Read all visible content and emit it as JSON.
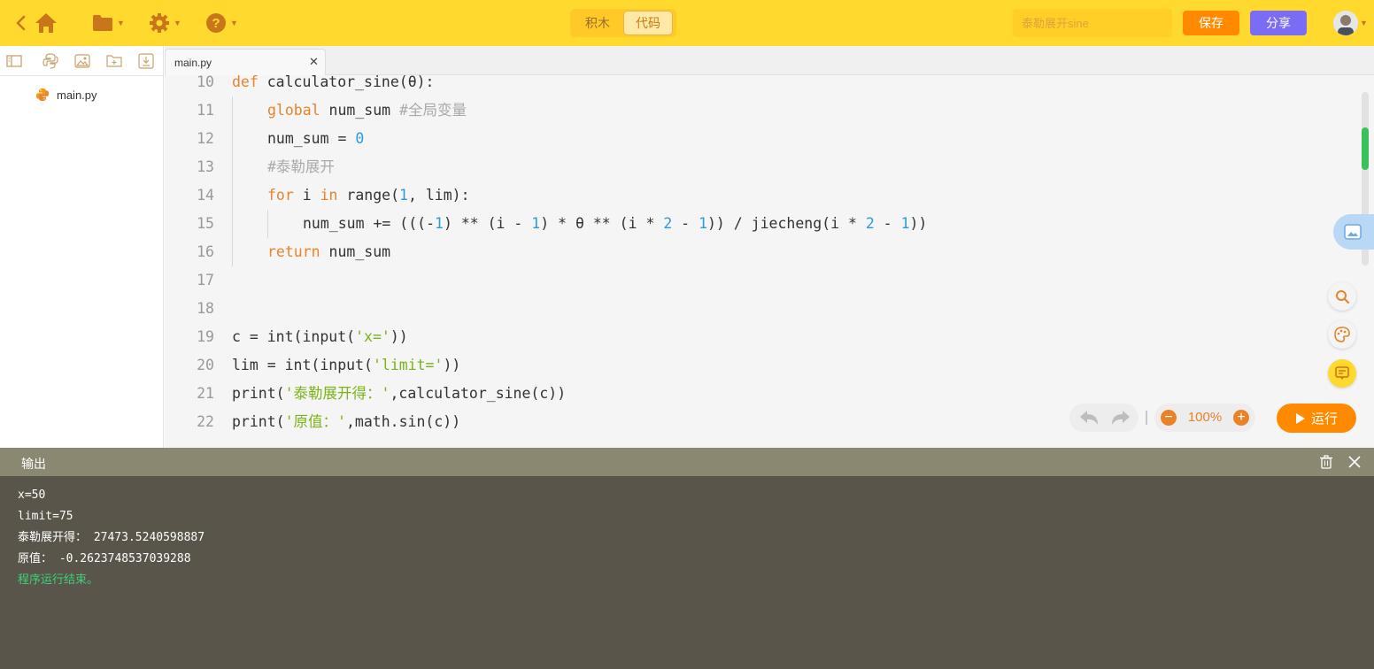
{
  "topbar": {
    "mode_tabs": [
      "积木",
      "代码"
    ],
    "active_mode": "代码",
    "title_input": {
      "value": "",
      "placeholder": "泰勒展开sine"
    },
    "save_label": "保存",
    "share_label": "分享"
  },
  "sidebar": {
    "files": [
      {
        "name": "main.py",
        "icon": "python-icon"
      }
    ]
  },
  "editor": {
    "tab": {
      "label": "main.py",
      "close": "✕"
    },
    "line_numbers": [
      "10",
      "11",
      "12",
      "13",
      "14",
      "15",
      "16",
      "17",
      "18",
      "19",
      "20",
      "21",
      "22"
    ],
    "lines": [
      {
        "indent": 0,
        "tokens": [
          {
            "t": "def",
            "c": "kw"
          },
          {
            "t": " calculator_sine(θ):",
            "c": ""
          }
        ]
      },
      {
        "indent": 1,
        "tokens": [
          {
            "t": "global",
            "c": "kw"
          },
          {
            "t": " num_sum ",
            "c": ""
          },
          {
            "t": "#全局变量",
            "c": "cm"
          }
        ]
      },
      {
        "indent": 1,
        "tokens": [
          {
            "t": "num_sum = ",
            "c": ""
          },
          {
            "t": "0",
            "c": "num"
          }
        ]
      },
      {
        "indent": 1,
        "tokens": [
          {
            "t": "#泰勒展开",
            "c": "cm"
          }
        ]
      },
      {
        "indent": 1,
        "tokens": [
          {
            "t": "for",
            "c": "kw"
          },
          {
            "t": " i ",
            "c": ""
          },
          {
            "t": "in",
            "c": "kw"
          },
          {
            "t": " range(",
            "c": ""
          },
          {
            "t": "1",
            "c": "num"
          },
          {
            "t": ", lim):",
            "c": ""
          }
        ]
      },
      {
        "indent": 2,
        "tokens": [
          {
            "t": "num_sum += (((-",
            "c": ""
          },
          {
            "t": "1",
            "c": "num"
          },
          {
            "t": ") ** (i - ",
            "c": ""
          },
          {
            "t": "1",
            "c": "num"
          },
          {
            "t": ") * θ ** (i * ",
            "c": ""
          },
          {
            "t": "2",
            "c": "num"
          },
          {
            "t": " - ",
            "c": ""
          },
          {
            "t": "1",
            "c": "num"
          },
          {
            "t": ")) / jiecheng(i * ",
            "c": ""
          },
          {
            "t": "2",
            "c": "num"
          },
          {
            "t": " - ",
            "c": ""
          },
          {
            "t": "1",
            "c": "num"
          },
          {
            "t": "))",
            "c": ""
          }
        ]
      },
      {
        "indent": 1,
        "tokens": [
          {
            "t": "return",
            "c": "kw"
          },
          {
            "t": " num_sum",
            "c": ""
          }
        ]
      },
      {
        "indent": 0,
        "tokens": []
      },
      {
        "indent": 0,
        "tokens": []
      },
      {
        "indent": 0,
        "tokens": [
          {
            "t": "c = int(input(",
            "c": ""
          },
          {
            "t": "'x='",
            "c": "str"
          },
          {
            "t": "))",
            "c": ""
          }
        ]
      },
      {
        "indent": 0,
        "tokens": [
          {
            "t": "lim = int(input(",
            "c": ""
          },
          {
            "t": "'limit='",
            "c": "str"
          },
          {
            "t": "))",
            "c": ""
          }
        ]
      },
      {
        "indent": 0,
        "tokens": [
          {
            "t": "print(",
            "c": ""
          },
          {
            "t": "'泰勒展开得：'",
            "c": "str"
          },
          {
            "t": ",calculator_sine(c))",
            "c": ""
          }
        ]
      },
      {
        "indent": 0,
        "tokens": [
          {
            "t": "print(",
            "c": ""
          },
          {
            "t": "'原值：'",
            "c": "str"
          },
          {
            "t": ",math.sin(c))",
            "c": ""
          }
        ]
      }
    ],
    "zoom_level": "100%",
    "run_label": "运行"
  },
  "output": {
    "title": "输出",
    "lines": [
      {
        "text": "x=50",
        "color": "#ffffff"
      },
      {
        "text": "limit=75",
        "color": "#ffffff"
      },
      {
        "text": "泰勒展开得： 27473.5240598887",
        "color": "#ffffff"
      },
      {
        "text": "原值： -0.2623748537039288",
        "color": "#ffffff"
      },
      {
        "text": "程序运行结束。",
        "color": "#3fd07a"
      }
    ]
  },
  "colors": {
    "topbar": "#ffd92e",
    "save": "#ff8a00",
    "share": "#7b6cf6",
    "run": "#ff8a00",
    "output_header": "#8b8872",
    "output_body": "#59554a"
  }
}
